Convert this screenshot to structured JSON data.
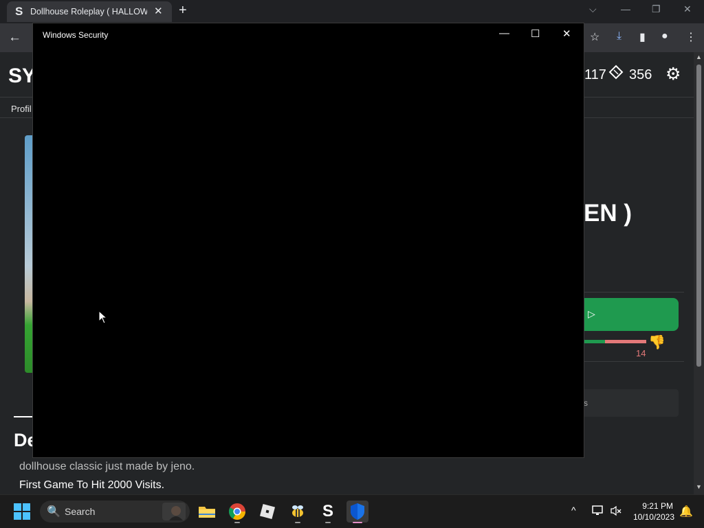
{
  "browser": {
    "tab": {
      "favicon": "S",
      "title": "Dollhouse Roleplay ( HALLOWEEN )",
      "close": "✕"
    },
    "new_tab": "+",
    "window_controls": {
      "dropdown": "⌵",
      "minimize": "—",
      "restore": "❐",
      "close": "✕"
    },
    "toolbar": {
      "back": "←",
      "bookmark": "☆",
      "download": "⤓",
      "side_panel": "▮",
      "profile": "●",
      "menu": "⋮"
    }
  },
  "page": {
    "logo_text": "SY",
    "robux": "117",
    "tickets": "356",
    "settings_icon": "⚙",
    "nav_profile": "Profil",
    "game_title_visible": "EN )",
    "play_icon": "▷",
    "dislikes": "14",
    "dislike_icon": "👎",
    "servers_text": "s",
    "description_heading": "De",
    "description_line1": "dollhouse classic just made by jeno.",
    "description_line2": "First Game To Hit 2000 Visits."
  },
  "dialog": {
    "title": "Windows Security",
    "minimize": "—",
    "maximize": "☐",
    "close": "✕"
  },
  "scrollbar": {
    "up": "▲",
    "down": "▼"
  },
  "taskbar": {
    "search_label": "Search",
    "search_glass": "🔍",
    "apps": [
      "file-explorer",
      "chrome",
      "roblox",
      "bee-app",
      "s-app",
      "windows-security"
    ],
    "s_app_letter": "S",
    "tray_chevron": "^",
    "time": "9:21 PM",
    "date": "10/10/2023",
    "bell": "🔔"
  },
  "colors": {
    "accent_green": "#1f9a4f",
    "dislike_red": "#e37979",
    "security_blue": "#1a73e8"
  }
}
